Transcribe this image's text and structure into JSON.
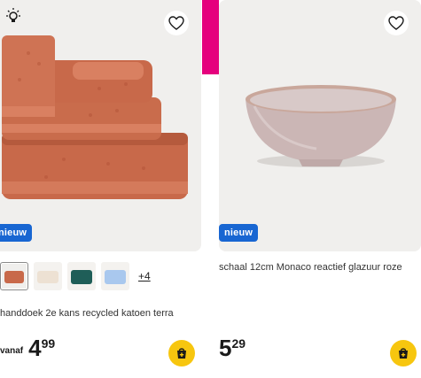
{
  "products": [
    {
      "badge": "nieuw",
      "title": "handdoek 2e kans recycled katoen terra",
      "price_prefix": "vanaf",
      "price_main": "4",
      "price_dec": "99",
      "more_colors": "+4",
      "swatch_colors": [
        "#c8694a",
        "#ede1d3",
        "#1f5e58",
        "#a9c8ee"
      ]
    },
    {
      "badge": "nieuw",
      "title": "schaal 12cm Monaco reactief glazuur roze",
      "price_main": "5",
      "price_dec": "29"
    }
  ],
  "colors": {
    "accent_pink": "#e5007d",
    "badge_blue": "#1866d2",
    "cart_yellow": "#f7c60f",
    "terra": "#c8694a"
  },
  "icons": [
    "bulb-icon",
    "heart-icon",
    "cart-add-icon"
  ]
}
